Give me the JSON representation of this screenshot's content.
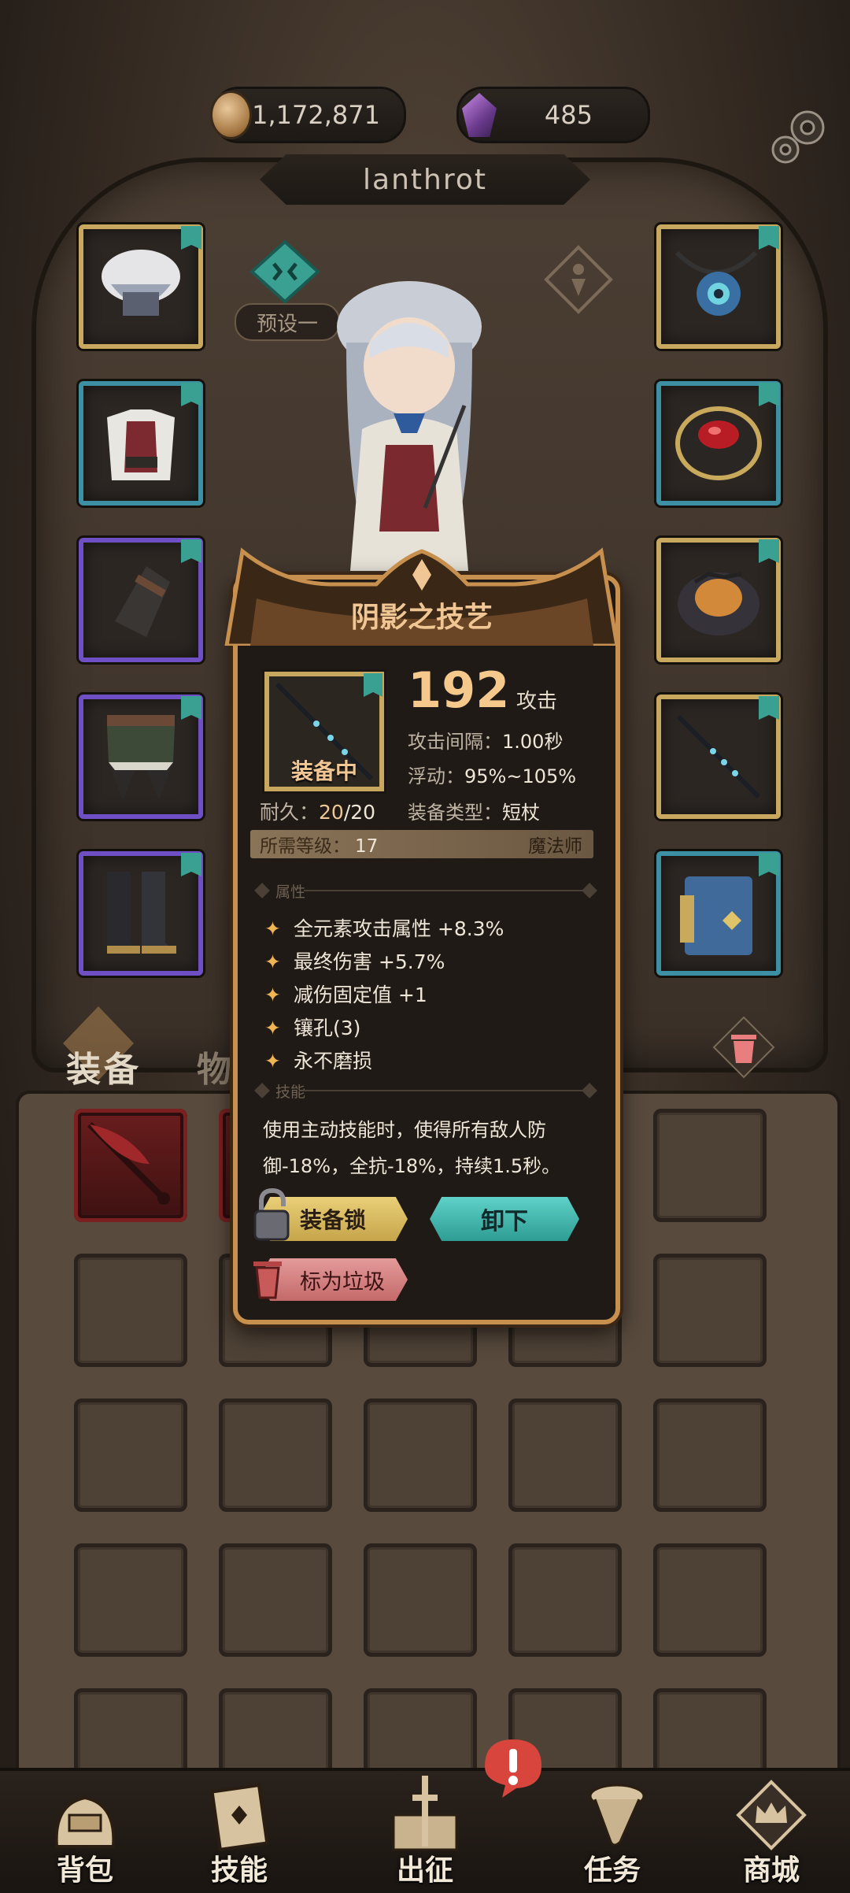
{
  "header": {
    "gold": "1,172,871",
    "gems": "485",
    "player_name": "lanthrot"
  },
  "preset": {
    "label": "预设一"
  },
  "tabs": {
    "equip": "装备",
    "items": "物品"
  },
  "tooltip": {
    "title": "阴影之技艺",
    "equipped_label": "装备中",
    "attack_value": "192",
    "attack_unit": "攻击",
    "attack_interval_label": "攻击间隔：",
    "attack_interval_value": "1.00秒",
    "float_label": "浮动：",
    "float_value": "95%~105%",
    "durability_label": "耐久：",
    "durability_current": "20",
    "durability_max": "/20",
    "equip_type_label": "装备类型：",
    "equip_type_value": "短杖",
    "required_level_label": "所需等级：",
    "required_level_value": "17",
    "class": "魔法师",
    "section_attributes": "属性",
    "attributes": [
      "全元素攻击属性 +8.3%",
      "最终伤害 +5.7%",
      "减伤固定值 +1",
      "镶孔(3)",
      "永不磨损"
    ],
    "section_skill": "技能",
    "skill_text": "使用主动技能时，使得所有敌人防御-18%，全抗-18%，持续1.5秒。",
    "btn_lock": "装备锁",
    "btn_unequip": "卸下",
    "btn_mark_trash": "标为垃圾"
  },
  "nav": {
    "bag": "背包",
    "skills": "技能",
    "battle": "出征",
    "quests": "任务",
    "shop": "商城"
  },
  "colors": {
    "gold_accent": "#f0c794",
    "teal_button": "#2e9d93",
    "rare_gold": "#c8a85e",
    "rare_teal": "#3d8fa3",
    "rare_purple": "#6f4fc4"
  }
}
